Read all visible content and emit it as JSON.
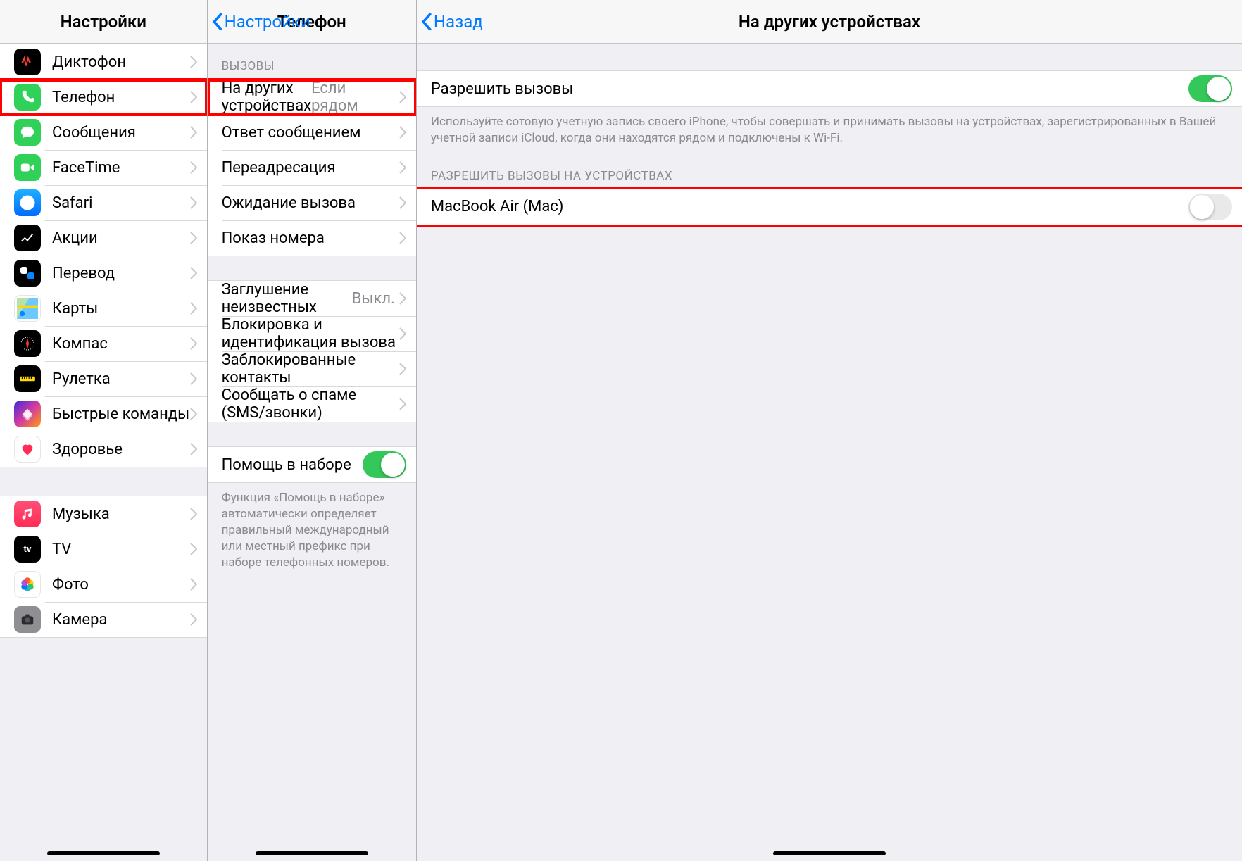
{
  "screen1": {
    "title": "Настройки",
    "items": [
      {
        "label": "Диктофон"
      },
      {
        "label": "Телефон"
      },
      {
        "label": "Сообщения"
      },
      {
        "label": "FaceTime"
      },
      {
        "label": "Safari"
      },
      {
        "label": "Акции"
      },
      {
        "label": "Перевод"
      },
      {
        "label": "Карты"
      },
      {
        "label": "Компас"
      },
      {
        "label": "Рулетка"
      },
      {
        "label": "Быстрые команды"
      },
      {
        "label": "Здоровье"
      }
    ],
    "items2": [
      {
        "label": "Музыка"
      },
      {
        "label": "TV"
      },
      {
        "label": "Фото"
      },
      {
        "label": "Камера"
      }
    ]
  },
  "screen2": {
    "back": "Настройки",
    "title": "Телефон",
    "group1_header": "ВЫЗОВЫ",
    "g1": {
      "other_devices": "На других устройствах",
      "other_devices_val": "Если рядом",
      "reply_msg": "Ответ сообщением",
      "forward": "Переадресация",
      "waiting": "Ожидание вызова",
      "show_num": "Показ номера"
    },
    "g2": {
      "silence": "Заглушение неизвестных",
      "silence_val": "Выкл.",
      "block_id": "Блокировка и идентификация вызова",
      "blocked": "Заблокированные контакты",
      "spam": "Сообщать о спаме (SMS/звонки)"
    },
    "g3": {
      "assist": "Помощь в наборе",
      "footer": "Функция «Помощь в наборе» автоматически определяет правильный международный или местный префикс при наборе телефонных номеров."
    }
  },
  "screen3": {
    "back": "Назад",
    "title": "На других устройствах",
    "allow": "Разрешить вызовы",
    "allow_footer": "Используйте сотовую учетную запись своего iPhone, чтобы совершать и принимать вызовы на устройствах, зарегистрированных в Вашей учетной записи iCloud, когда они находятся рядом и подключены к Wi-Fi.",
    "group2_header": "РАЗРЕШИТЬ ВЫЗОВЫ НА УСТРОЙСТВАХ",
    "device1": "MacBook Air (Mac)"
  }
}
